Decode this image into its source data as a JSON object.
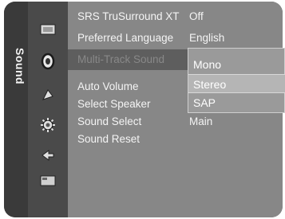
{
  "side_tab": {
    "label": "Sound",
    "icons": [
      "picture-icon",
      "sound-icon",
      "channel-icon",
      "setup-icon",
      "input-icon",
      "application-icon"
    ]
  },
  "menu": {
    "items": [
      {
        "label": "SRS TruSurround XT",
        "value": "Off"
      },
      {
        "label": "Preferred Language",
        "value": "English"
      },
      {
        "label": "Multi-Track Sound",
        "value": ""
      },
      {
        "label": "Auto Volume",
        "value": ""
      },
      {
        "label": "Select Speaker",
        "value": ""
      },
      {
        "label": "Sound Select",
        "value": "Main"
      },
      {
        "label": "Sound Reset",
        "value": ""
      }
    ]
  },
  "dropdown": {
    "options": [
      "Mono",
      "Stereo",
      "SAP"
    ],
    "selected": "Stereo"
  }
}
